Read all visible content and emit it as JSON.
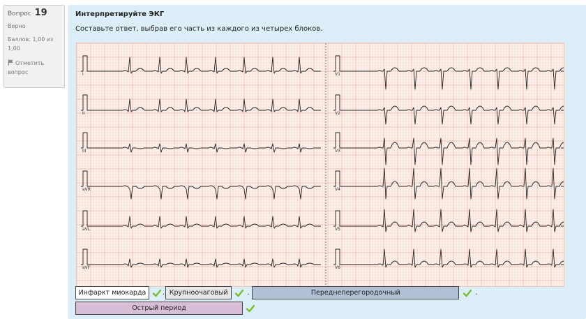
{
  "info": {
    "question_label": "Вопрос",
    "question_number": "19",
    "state": "Верно",
    "grade": "Баллов: 1,00 из 1,00",
    "flag": "Отметить вопрос"
  },
  "question": {
    "title": "Интерпретируйте ЭКГ",
    "text": "Составьте ответ, выбрав его часть из каждого из четырех блоков."
  },
  "ecg": {
    "left_leads": [
      "I",
      "II",
      "III",
      "aVR",
      "aVL",
      "aVF"
    ],
    "right_leads": [
      "V1",
      "V2",
      "V3",
      "V4",
      "V5",
      "V6"
    ]
  },
  "answers": [
    {
      "text": "Инфаркт миокарда",
      "color": "#ffffff"
    },
    {
      "text": "Крупноочаговый",
      "color": "#e6e6e6"
    },
    {
      "text": "Переднеперегородочный",
      "color": "#b2c0d6"
    },
    {
      "text": "Острый период",
      "color": "#d9bed7"
    }
  ],
  "separator": ".",
  "check_color": "#7cbb2f"
}
